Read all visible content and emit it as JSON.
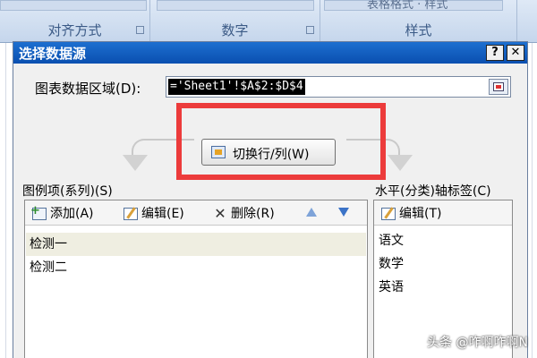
{
  "ribbon": {
    "groups": [
      "对齐方式",
      "数字",
      "样式"
    ],
    "ghost_right": "表格格式 · 样式"
  },
  "dialog": {
    "title": "选择数据源",
    "help_label": "?",
    "close_label": "✕",
    "range_label": "图表数据区域(D):",
    "range_value": "='Sheet1'!$A$2:$D$4",
    "switch_label": "切换行/列(W)"
  },
  "legend": {
    "label": "图例项(系列)(S)",
    "add_label": "添加(A)",
    "edit_label": "编辑(E)",
    "delete_label": "删除(R)",
    "items": [
      "检测一",
      "检测二"
    ]
  },
  "axis": {
    "label": "水平(分类)轴标签(C)",
    "edit_label": "编辑(T)",
    "items": [
      "语文",
      "数学",
      "英语"
    ]
  },
  "watermark": "头条 @咋啊咋啊N"
}
